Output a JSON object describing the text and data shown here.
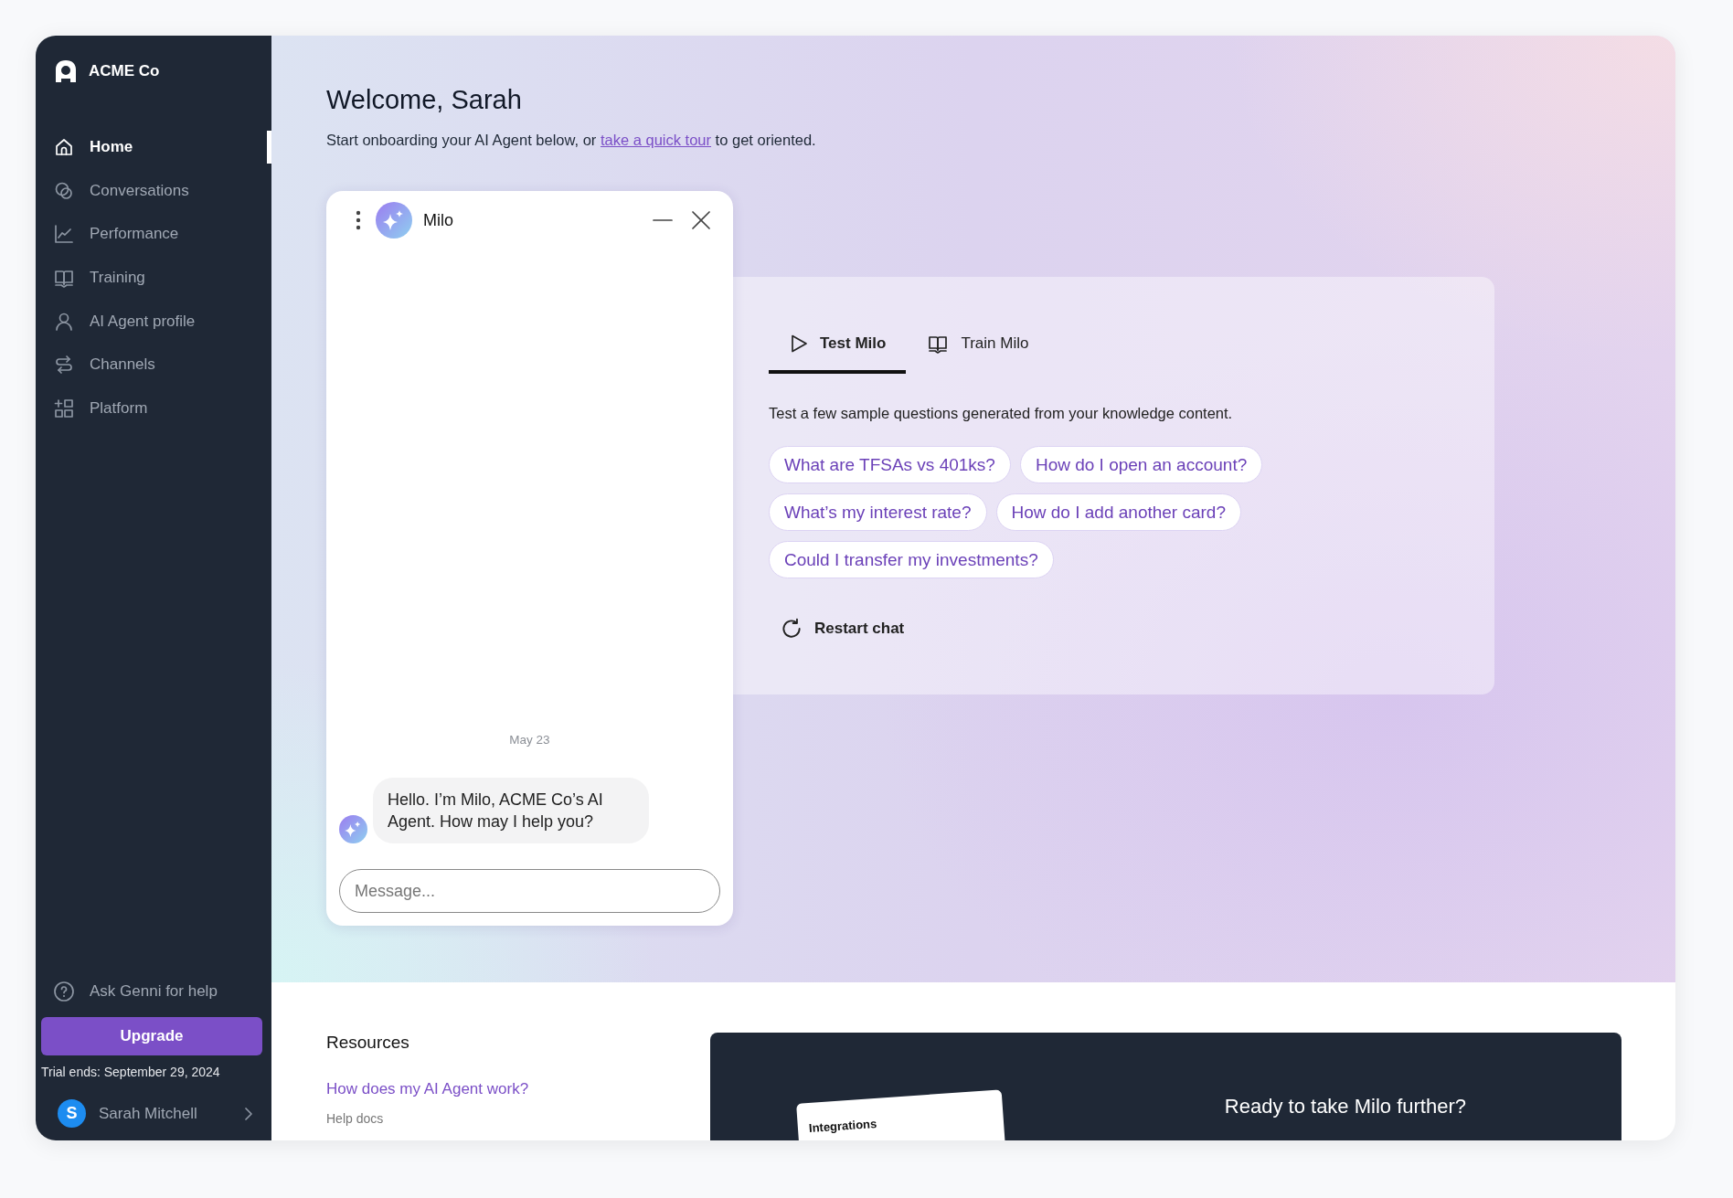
{
  "brand": {
    "name": "ACME Co"
  },
  "sidebar": {
    "items": [
      {
        "label": "Home",
        "selected": true
      },
      {
        "label": "Conversations",
        "selected": false
      },
      {
        "label": "Performance",
        "selected": false
      },
      {
        "label": "Training",
        "selected": false
      },
      {
        "label": "AI Agent profile",
        "selected": false
      },
      {
        "label": "Channels",
        "selected": false
      },
      {
        "label": "Platform",
        "selected": false
      }
    ],
    "help": "Ask Genni for help",
    "upgrade": "Upgrade",
    "trial": "Trial ends: September 29, 2024",
    "user": {
      "initial": "S",
      "name": "Sarah Mitchell"
    }
  },
  "header": {
    "title": "Welcome, Sarah",
    "subtitle_before": "Start onboarding your AI Agent below, or ",
    "link": "take a quick tour",
    "subtitle_after": " to get oriented."
  },
  "chat": {
    "title": "Milo",
    "date": "May 23",
    "messages": [
      {
        "text": "Hello. I’m Milo, ACME Co’s AI Agent. How may I help you?"
      }
    ],
    "placeholder": "Message..."
  },
  "test_panel": {
    "tabs": [
      {
        "label": "Test Milo",
        "selected": true
      },
      {
        "label": "Train Milo",
        "selected": false
      }
    ],
    "description": "Test a few sample questions generated from your knowledge content.",
    "questions": [
      "What are TFSAs vs 401ks?",
      "How do I open an account?",
      "What’s my interest rate?",
      "How do I add another card?",
      "Could I transfer my investments?"
    ],
    "restart": "Restart chat"
  },
  "resources": {
    "title": "Resources",
    "items": [
      {
        "title": "How does my AI Agent work?",
        "subtitle": "Help docs"
      }
    ]
  },
  "promo": {
    "title": "Ready to take Milo further?",
    "card_title": "Integrations"
  }
}
